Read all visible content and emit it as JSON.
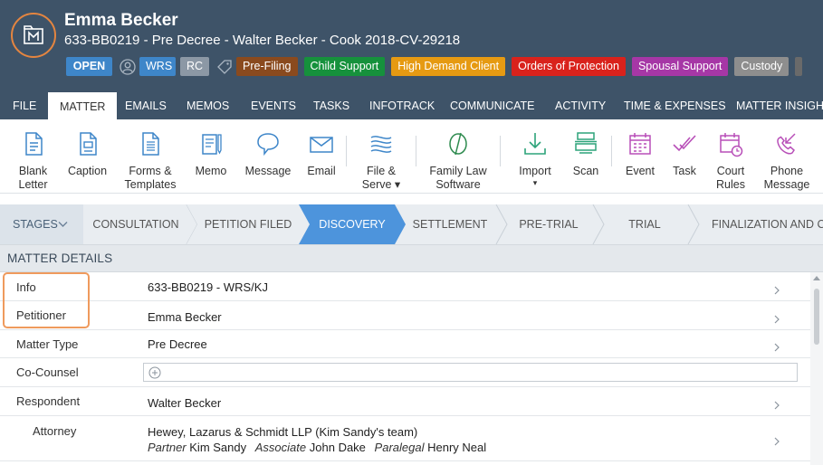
{
  "header": {
    "client_name": "Emma Becker",
    "matter_line": "633-BB0219 - Pre Decree - Walter Becker - Cook 2018-CV-29218",
    "status": "OPEN",
    "staff_tags": [
      "WRS",
      "RC"
    ],
    "tags": [
      {
        "label": "Pre-Filing",
        "color": "#8a4a1e"
      },
      {
        "label": "Child Support",
        "color": "#16913c"
      },
      {
        "label": "High Demand Client",
        "color": "#e69a12"
      },
      {
        "label": "Orders of Protection",
        "color": "#d9221c"
      },
      {
        "label": "Spousal Support",
        "color": "#a637a6"
      },
      {
        "label": "Custody",
        "color": "#8e8e8e"
      }
    ],
    "accent_color": "#e48540",
    "background_color": "#3e5368"
  },
  "menu_tabs": [
    "FILE",
    "MATTER",
    "EMAILS",
    "MEMOS",
    "EVENTS",
    "TASKS",
    "INFOTRACK",
    "COMMUNICATE",
    "ACTIVITY",
    "TIME & EXPENSES",
    "MATTER INSIGHTS"
  ],
  "active_tab": "MATTER",
  "toolbar": {
    "blank_letter": [
      "Blank",
      "Letter"
    ],
    "caption": "Caption",
    "forms_templates": [
      "Forms &",
      "Templates"
    ],
    "memo": "Memo",
    "message": "Message",
    "email": "Email",
    "file_serve": [
      "File &",
      "Serve ▾"
    ],
    "family_law_software": [
      "Family Law",
      "Software"
    ],
    "import": [
      "Import",
      "▾"
    ],
    "scan": "Scan",
    "event": "Event",
    "task": "Task",
    "court_rules": [
      "Court",
      "Rules"
    ],
    "phone_message": [
      "Phone",
      "Message"
    ]
  },
  "stages": {
    "label": "STAGES",
    "items": [
      "CONSULTATION",
      "PETITION FILED",
      "DISCOVERY",
      "SETTLEMENT",
      "PRE-TRIAL",
      "TRIAL",
      "FINALIZATION AND CO"
    ],
    "active": "DISCOVERY",
    "active_color": "#4d94dc"
  },
  "matter_details": {
    "title": "MATTER DETAILS",
    "info_label": "Info",
    "info_value": "633-BB0219 - WRS/KJ",
    "petitioner_label": "Petitioner",
    "petitioner_value": "Emma Becker",
    "matter_type_label": "Matter Type",
    "matter_type_value": "Pre Decree",
    "co_counsel_label": "Co-Counsel",
    "respondent_label": "Respondent",
    "respondent_value": "Walter Becker",
    "attorney_label": "Attorney",
    "attorney_firm": "Hewey, Lazarus & Schmidt LLP (Kim Sandy's team)",
    "attorney_roles": [
      {
        "role": "Partner",
        "name": "Kim Sandy"
      },
      {
        "role": "Associate",
        "name": "John Dake"
      },
      {
        "role": "Paralegal",
        "name": "Henry Neal"
      }
    ]
  }
}
